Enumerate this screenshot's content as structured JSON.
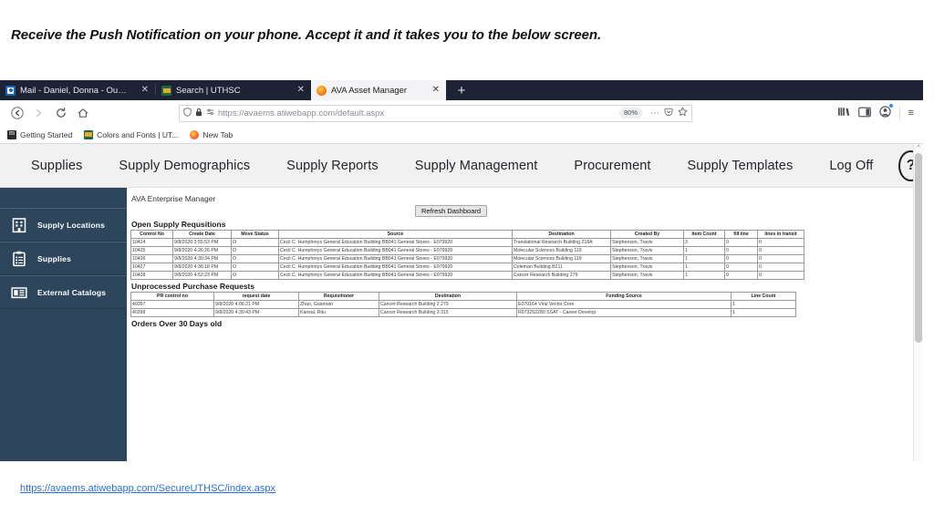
{
  "slide": {
    "caption": "Receive the Push Notification on your phone. Accept it and it takes you to the below screen.",
    "bottom_link": "https://avaems.atiwebapp.com/SecureUTHSC/index.aspx"
  },
  "browser": {
    "tabs": [
      {
        "title": "Mail - Daniel, Donna - Outlook",
        "favicon": "outlook-icon",
        "active": false,
        "close": "✕"
      },
      {
        "title": "Search | UTHSC",
        "favicon": "uthsc-icon",
        "active": false,
        "close": "✕"
      },
      {
        "title": "AVA Asset Manager",
        "favicon": "firefox-icon",
        "active": true,
        "close": "✕"
      }
    ],
    "new_tab_label": "+",
    "nav": {
      "back": "←",
      "forward": "→",
      "reload": "⟳",
      "home": "⌂"
    },
    "address": {
      "url_prefix": "https://",
      "url_domain": "avaems.atiwebapp.com",
      "url_path": "/default.aspx",
      "full_url": "https://avaems.atiwebapp.com/default.aspx",
      "zoom_level": "80%",
      "shield_icon": "⛉",
      "lock_icon": "ὑ2",
      "permissions_icon": "⎇",
      "more_icon": "⋯",
      "pocket_icon": "▽",
      "bookmark_star": "☆"
    },
    "toolbar_right": {
      "library_icon": "library-icon",
      "reader_icon": "sidebar-icon",
      "account_icon": "account-icon",
      "menu_icon": "≡"
    },
    "bookmarks": [
      {
        "label": "Getting Started",
        "icon": "firefox-bookmark-icon"
      },
      {
        "label": "Colors and Fonts | UT...",
        "icon": "uthsc-bookmark-icon"
      },
      {
        "label": "New Tab",
        "icon": "newtab-icon"
      }
    ]
  },
  "app": {
    "topnav": [
      {
        "label": "Supplies"
      },
      {
        "label": "Supply Demographics"
      },
      {
        "label": "Supply Reports"
      },
      {
        "label": "Supply Management"
      },
      {
        "label": "Procurement"
      },
      {
        "label": "Supply Templates"
      },
      {
        "label": "Log Off"
      }
    ],
    "help_label": "?",
    "sidebar": [
      {
        "label": "Supply Locations",
        "icon": "building-icon"
      },
      {
        "label": "Supplies",
        "icon": "clipboard-list-icon"
      },
      {
        "label": "External Catalogs",
        "icon": "catalog-icon"
      }
    ],
    "title": "AVA Enterprise Manager",
    "refresh_button": "Refresh Dashboard",
    "sections": {
      "open_requisitions": {
        "heading": "Open Supply Requsitions",
        "columns": [
          "Control No",
          "Create Date",
          "Move Status",
          "Source",
          "Destination",
          "Created By",
          "Item Count",
          "fill line",
          "lines in transit"
        ],
        "rows": [
          {
            "control_no": "10424",
            "create_date": "9/8/2020 3:55:53 PM",
            "move_status": "O",
            "source": "Cecil C. Humphreys General Education Building BB041 General Stores - E079920",
            "destination": "Translational Research Building 218A",
            "created_by": "Stephenson, Travis",
            "item_count": "3",
            "fill_line": "0",
            "lines_in_transit": "0"
          },
          {
            "control_no": "10425",
            "create_date": "9/8/2020 4:26:26 PM",
            "move_status": "O",
            "source": "Cecil C. Humphreys General Education Building BB041 General Stores - E079920",
            "destination": "Molecular Sciences Building 119",
            "created_by": "Stephenson, Travis",
            "item_count": "1",
            "fill_line": "0",
            "lines_in_transit": "0"
          },
          {
            "control_no": "10426",
            "create_date": "9/8/2020 4:30:34 PM",
            "move_status": "O",
            "source": "Cecil C. Humphreys General Education Building BB041 General Stores - E079920",
            "destination": "Molecular Sciences Building 119",
            "created_by": "Stephenson, Travis",
            "item_count": "1",
            "fill_line": "0",
            "lines_in_transit": "0"
          },
          {
            "control_no": "10427",
            "create_date": "9/8/2020 4:36:18 PM",
            "move_status": "O",
            "source": "Cecil C. Humphreys General Education Building BB041 General Stores - E079920",
            "destination": "Coleman Building B211",
            "created_by": "Stephenson, Travis",
            "item_count": "1",
            "fill_line": "0",
            "lines_in_transit": "0"
          },
          {
            "control_no": "10428",
            "create_date": "9/8/2020 4:52:23 PM",
            "move_status": "O",
            "source": "Cecil C. Humphreys General Education Building BB041 General Stores - E079920",
            "destination": "Cancer Research Building 279",
            "created_by": "Stephenson, Travis",
            "item_count": "1",
            "fill_line": "0",
            "lines_in_transit": "0"
          }
        ]
      },
      "unprocessed_requests": {
        "heading": "Unprocessed Purchase Requests",
        "columns": [
          "PR control no",
          "request date",
          "Requisitioner",
          "Destination",
          "Funding Source",
          "Line Count"
        ],
        "rows": [
          {
            "pr_control_no": "40397",
            "request_date": "9/8/2020 4:06:21 PM",
            "requisitioner": "Zhao, Guannan",
            "destination": "Cancer Research Building 2 279",
            "funding_source": "E070164 Viral Vector Core",
            "line_count": "1"
          },
          {
            "pr_control_no": "40398",
            "request_date": "9/8/2020 4:39:43 PM",
            "requisitioner": "Kansal, Ritu",
            "destination": "Cancer Research Building 3 315",
            "funding_source": "R073252280 SSAT - Career Develop",
            "line_count": "1"
          }
        ]
      },
      "orders_over_30": {
        "heading": "Orders Over 30 Days old"
      }
    }
  },
  "colors": {
    "tabstrip_bg": "#1e2235",
    "sidebar_bg": "#2e465c",
    "appnav_bg": "#f1f1f1",
    "link_blue": "#2a6fdb"
  }
}
